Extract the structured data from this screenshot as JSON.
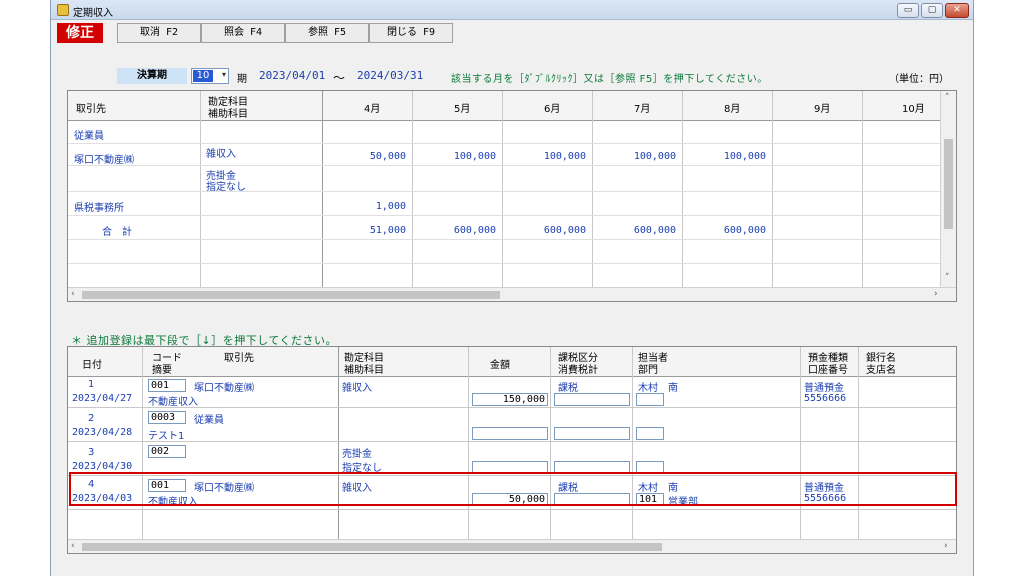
{
  "window": {
    "title": "定期収入",
    "buttons": {
      "minimize": "▭",
      "restore": "▢",
      "close": "✕"
    }
  },
  "toolbar": {
    "mode": "修正",
    "cancel": "取消 F2",
    "inquiry": "照会 F4",
    "reference": "参照 F5",
    "close": "閉じる F9"
  },
  "filter": {
    "label": "決算期",
    "period_value": "10",
    "period_suffix": "期",
    "date_from": "2023/04/01",
    "tilde": "〜",
    "date_to": "2024/03/31",
    "hint": "該当する月を［ﾀﾞﾌﾞﾙｸﾘｯｸ］又は［参照 F5］を押下してください。",
    "unit": "（単位：円）"
  },
  "monthly_grid": {
    "headers": {
      "partner": "取引先",
      "account_line1": "勘定科目",
      "account_line2": "補助科目",
      "months": [
        "4月",
        "5月",
        "6月",
        "7月",
        "8月",
        "9月",
        "10月"
      ]
    },
    "rows": [
      {
        "partner": "従業員",
        "account": "",
        "values": [
          "",
          "",
          "",
          "",
          "",
          "",
          ""
        ]
      },
      {
        "partner": "塚口不動産㈱",
        "account": "雑収入",
        "values": [
          "50,000",
          "100,000",
          "100,000",
          "100,000",
          "100,000",
          "",
          ""
        ]
      },
      {
        "partner": "",
        "account": "売掛金",
        "account2": "指定なし",
        "values": [
          "",
          "",
          "",
          "",
          "",
          "",
          ""
        ]
      },
      {
        "partner": "県税事務所",
        "account": "",
        "values": [
          "1,000",
          "",
          "",
          "",
          "",
          "",
          ""
        ]
      },
      {
        "partner": "合　計",
        "account": "",
        "values": [
          "51,000",
          "600,000",
          "600,000",
          "600,000",
          "600,000",
          "",
          ""
        ]
      }
    ]
  },
  "note": "＊ 追加登録は最下段で［↓］を押下してください。",
  "entry_grid": {
    "headers": {
      "date": "日付",
      "code_line1": "コード",
      "code_line2": "摘要",
      "partner": "取引先",
      "account_line1": "勘定科目",
      "account_line2": "補助科目",
      "amount": "金額",
      "tax_line1": "課税区分",
      "tax_line2": "消費税計",
      "person_line1": "担当者",
      "person_line2": "部門",
      "deposit_line1": "預金種類",
      "deposit_line2": "口座番号",
      "bank_line1": "銀行名",
      "bank_line2": "支店名"
    },
    "rows": [
      {
        "no": "1",
        "date": "2023/04/27",
        "code": "001",
        "partner": "塚口不動産㈱",
        "summary": "不動産収入",
        "account": "雑収入",
        "account2": "",
        "amount": "150,000",
        "tax": "課税",
        "person": "木村　南",
        "dept_code": "",
        "dept": "",
        "deposit": "普通預金",
        "account_no": "5556666"
      },
      {
        "no": "2",
        "date": "2023/04/28",
        "code": "0003",
        "partner": "従業員",
        "summary": "テスト1",
        "account": "",
        "account2": "",
        "amount": "",
        "tax": "",
        "person": "",
        "dept_code": "",
        "dept": "",
        "deposit": "",
        "account_no": ""
      },
      {
        "no": "3",
        "date": "2023/04/30",
        "code": "002",
        "partner": "",
        "summary": "",
        "account": "売掛金",
        "account2": "指定なし",
        "amount": "",
        "tax": "",
        "person": "",
        "dept_code": "",
        "dept": "",
        "deposit": "",
        "account_no": ""
      },
      {
        "no": "4",
        "date": "2023/04/03",
        "code": "001",
        "partner": "塚口不動産㈱",
        "summary": "不動産収入",
        "account": "雑収入",
        "account2": "",
        "amount": "50,000",
        "tax": "課税",
        "person": "木村　南",
        "dept_code": "101",
        "dept": "営業部",
        "deposit": "普通預金",
        "account_no": "5556666"
      }
    ]
  },
  "colors": {
    "mode_bg": "#d40000",
    "value_text": "#1b3fb0",
    "hint_text": "#0b7a3a",
    "highlight": "#d40000"
  }
}
